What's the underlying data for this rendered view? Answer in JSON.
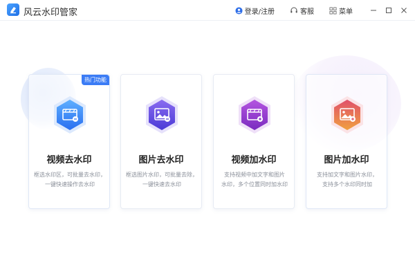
{
  "app": {
    "title": "风云水印管家"
  },
  "header": {
    "login_label": "登录/注册",
    "service_label": "客服",
    "menu_label": "菜单"
  },
  "cards": [
    {
      "title": "视频去水印",
      "desc_line1": "框选水印区，可批量去水印，",
      "desc_line2": "一键快速操作去水印",
      "badge": "热门功能",
      "icon": "video-remove-icon",
      "color_top": "#5fb0ff",
      "color_bottom": "#2a6ff0"
    },
    {
      "title": "图片去水印",
      "desc_line1": "框选图片水印，可批量去除，",
      "desc_line2": "一键快速去水印",
      "icon": "image-remove-icon",
      "color_top": "#8a6cf0",
      "color_bottom": "#4a3ad6"
    },
    {
      "title": "视频加水印",
      "desc_line1": "支持视频中加文字和图片",
      "desc_line2": "水印，多个位置同时加水印",
      "icon": "video-add-icon",
      "color_top": "#b455e0",
      "color_bottom": "#7a2bbf"
    },
    {
      "title": "图片加水印",
      "desc_line1": "支持加文字和图片水印，",
      "desc_line2": "支持多个水印同时加",
      "icon": "image-add-icon",
      "color_top": "#e0506a",
      "color_bottom": "#f0a040"
    }
  ]
}
